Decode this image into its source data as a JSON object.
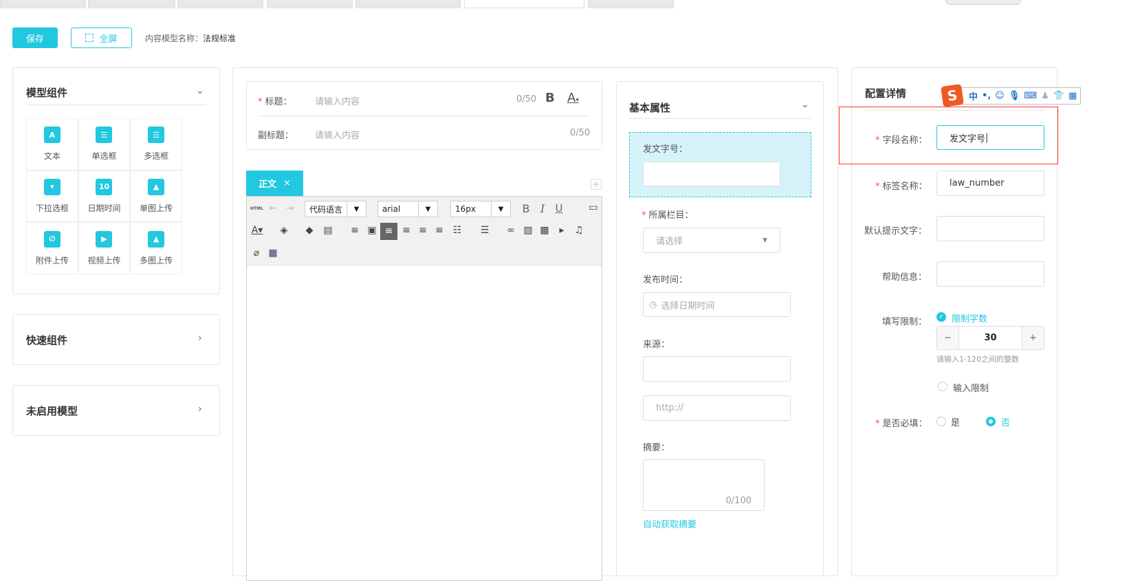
{
  "toolbar": {
    "save": "保存",
    "fullscreen": "全屏",
    "model_name_label": "内容模型名称：",
    "model_name": "法规标准"
  },
  "left": {
    "components_title": "模型组件",
    "components": [
      "文本",
      "单选框",
      "多选框",
      "下拉选框",
      "日期时间",
      "单图上传",
      "附件上传",
      "视频上传",
      "多图上传"
    ],
    "quick_title": "快速组件",
    "disabled_title": "未启用模型"
  },
  "editor": {
    "title_label": "标题：",
    "title_placeholder": "请输入内容",
    "title_count": "0/50",
    "subtitle_label": "副标题：",
    "subtitle_placeholder": "请输入内容",
    "subtitle_count": "0/50",
    "tab": "正文",
    "tab_close": "×",
    "html": "HTML",
    "code_lang": "代码语言",
    "font": "arial",
    "size": "16px"
  },
  "basic": {
    "title": "基本属性",
    "doc_number_label": "发文字号：",
    "column_label": "所属栏目：",
    "column_placeholder": "请选择",
    "time_label": "发布时间：",
    "time_placeholder": "选择日期时间",
    "source_label": "来源：",
    "url_placeholder": "http://",
    "summary_label": "摘要：",
    "summary_count": "0/100",
    "auto_summary": "自动获取摘要"
  },
  "config": {
    "title": "配置详情",
    "field_name_label": "字段名称：",
    "field_name": "发文字号",
    "tag_name_label": "标签名称：",
    "tag_name": "law_number",
    "default_hint_label": "默认提示文字：",
    "help_label": "帮助信息：",
    "limit_label": "填写限制：",
    "limit_chars": "限制字数",
    "limit_value": "30",
    "limit_hint": "请输入1-120之间的整数",
    "input_limit": "输入限制",
    "required_label": "是否必填：",
    "yes": "是",
    "no": "否",
    "minus": "−",
    "plus": "+"
  },
  "ime": {
    "lang": "中",
    "punct": "•,"
  },
  "colors": {
    "accent": "#22c7e0",
    "highlight": "#d5f3f8",
    "required": "#ff4444"
  }
}
